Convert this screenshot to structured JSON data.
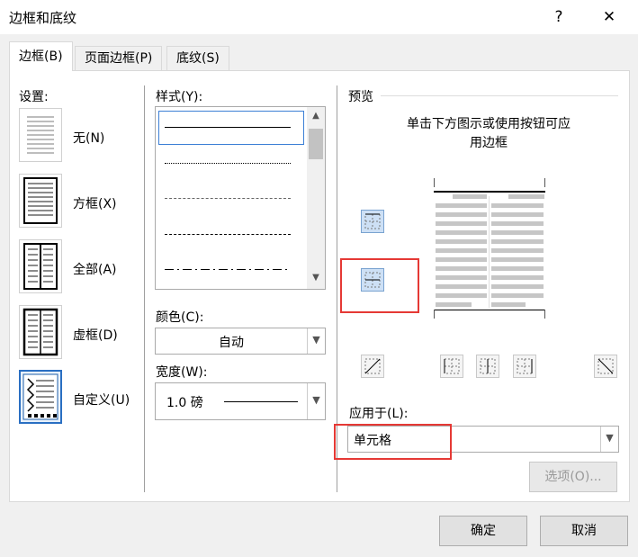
{
  "window": {
    "title": "边框和底纹",
    "help": "?",
    "close": "✕"
  },
  "tabs": [
    {
      "label": "边框(B)",
      "active": true
    },
    {
      "label": "页面边框(P)",
      "active": false
    },
    {
      "label": "底纹(S)",
      "active": false
    }
  ],
  "settings": {
    "heading": "设置:",
    "items": [
      {
        "label": "无(N)",
        "icon": "border-none-icon"
      },
      {
        "label": "方框(X)",
        "icon": "border-box-icon"
      },
      {
        "label": "全部(A)",
        "icon": "border-all-icon"
      },
      {
        "label": "虚框(D)",
        "icon": "border-grid-icon"
      },
      {
        "label": "自定义(U)",
        "icon": "border-custom-icon",
        "selected": true
      }
    ]
  },
  "style": {
    "heading": "样式(Y):",
    "options": [
      "solid",
      "dotted",
      "dashed-fine",
      "dashed",
      "dash-dot"
    ],
    "selected": "solid"
  },
  "color": {
    "heading": "颜色(C):",
    "value": "自动"
  },
  "width": {
    "heading": "宽度(W):",
    "value": "1.0 磅"
  },
  "preview": {
    "heading": "预览",
    "hint_line1": "单击下方图示或使用按钮可应",
    "hint_line2": "用边框"
  },
  "apply_to": {
    "heading": "应用于(L):",
    "value": "单元格"
  },
  "buttons": {
    "options": "选项(O)...",
    "ok": "确定",
    "cancel": "取消"
  },
  "colors": {
    "accent": "#2a6fc2",
    "highlight": "#e53935"
  }
}
